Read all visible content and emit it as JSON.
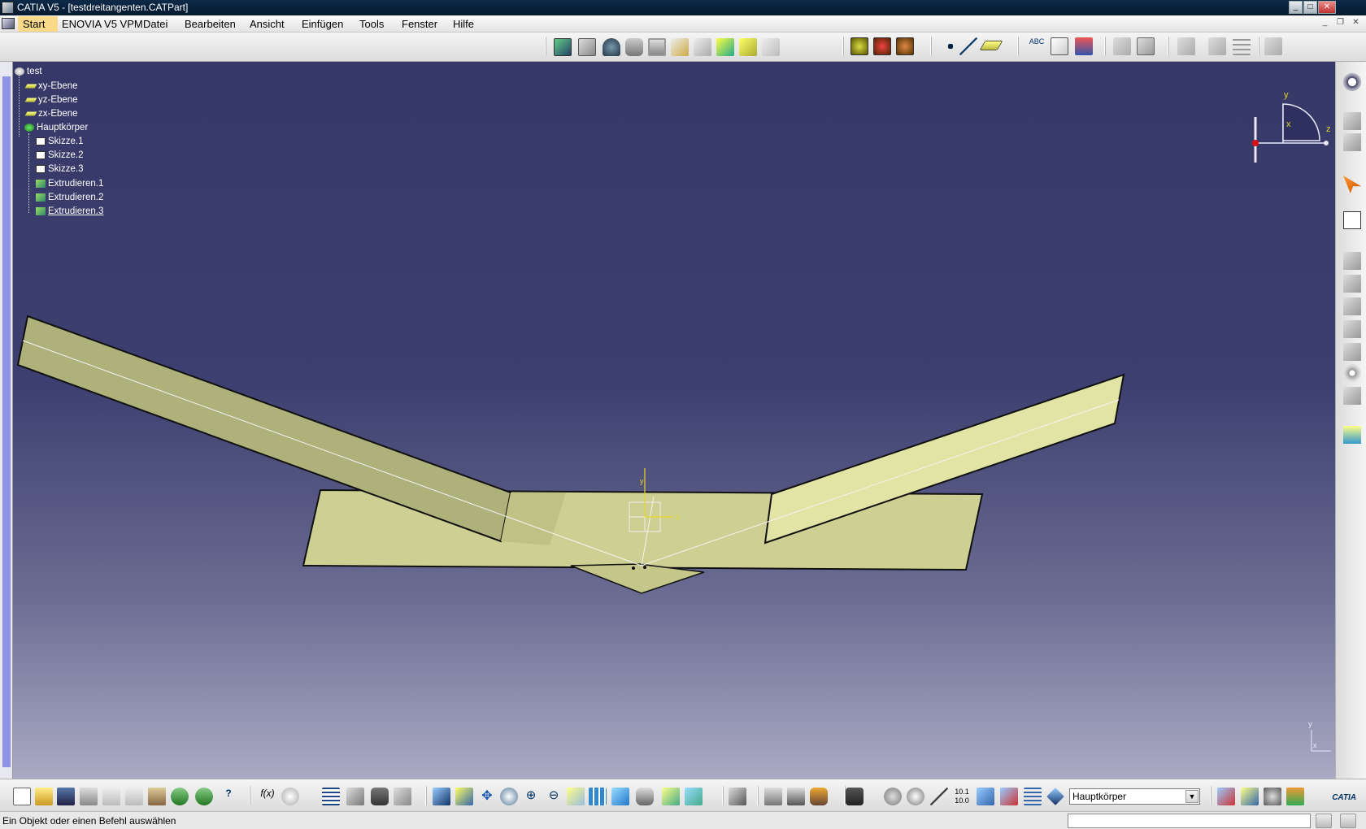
{
  "window": {
    "title": "CATIA V5 - [testdreitangenten.CATPart]",
    "app_icon": "catia-app-icon",
    "controls": [
      "minimize-icon",
      "maximize-icon",
      "close-icon"
    ]
  },
  "menu": {
    "items": [
      {
        "label": "Start",
        "active": true
      },
      {
        "label": "ENOVIA V5 VPM"
      },
      {
        "label": "Datei"
      },
      {
        "label": "Bearbeiten"
      },
      {
        "label": "Ansicht"
      },
      {
        "label": "Einfügen"
      },
      {
        "label": "Tools"
      },
      {
        "label": "Fenster"
      },
      {
        "label": "Hilfe"
      }
    ]
  },
  "tree": {
    "root": "test",
    "items": [
      {
        "label": "xy-Ebene",
        "icon": "plane-icon"
      },
      {
        "label": "yz-Ebene",
        "icon": "plane-icon"
      },
      {
        "label": "zx-Ebene",
        "icon": "plane-icon"
      },
      {
        "label": "Hauptkörper",
        "icon": "body-icon"
      },
      {
        "label": "Skizze.1",
        "icon": "sketch-icon"
      },
      {
        "label": "Skizze.2",
        "icon": "sketch-icon"
      },
      {
        "label": "Skizze.3",
        "icon": "sketch-icon"
      },
      {
        "label": "Extrudieren.1",
        "icon": "extrude-icon"
      },
      {
        "label": "Extrudieren.2",
        "icon": "extrude-icon"
      },
      {
        "label": "Extrudieren.3",
        "icon": "extrude-icon",
        "selected": true
      }
    ]
  },
  "compass": {
    "axis_x": "x",
    "axis_y": "y",
    "axis_z": "z"
  },
  "model_axis": {
    "y": "y",
    "z": "z"
  },
  "view_axis": {
    "y": "y",
    "x": "x"
  },
  "body_select": {
    "value": "Hauptkörper"
  },
  "status": {
    "text": "Ein Objekt oder einen Befehl auswählen"
  },
  "colors": {
    "viewport_top": "#363867",
    "viewport_bottom": "#aaaac4",
    "part_face": "#d4d79c",
    "part_face_shadow": "#b0b381",
    "menu_active": "#fbd98b",
    "tree_bar": "#8f93e8"
  }
}
